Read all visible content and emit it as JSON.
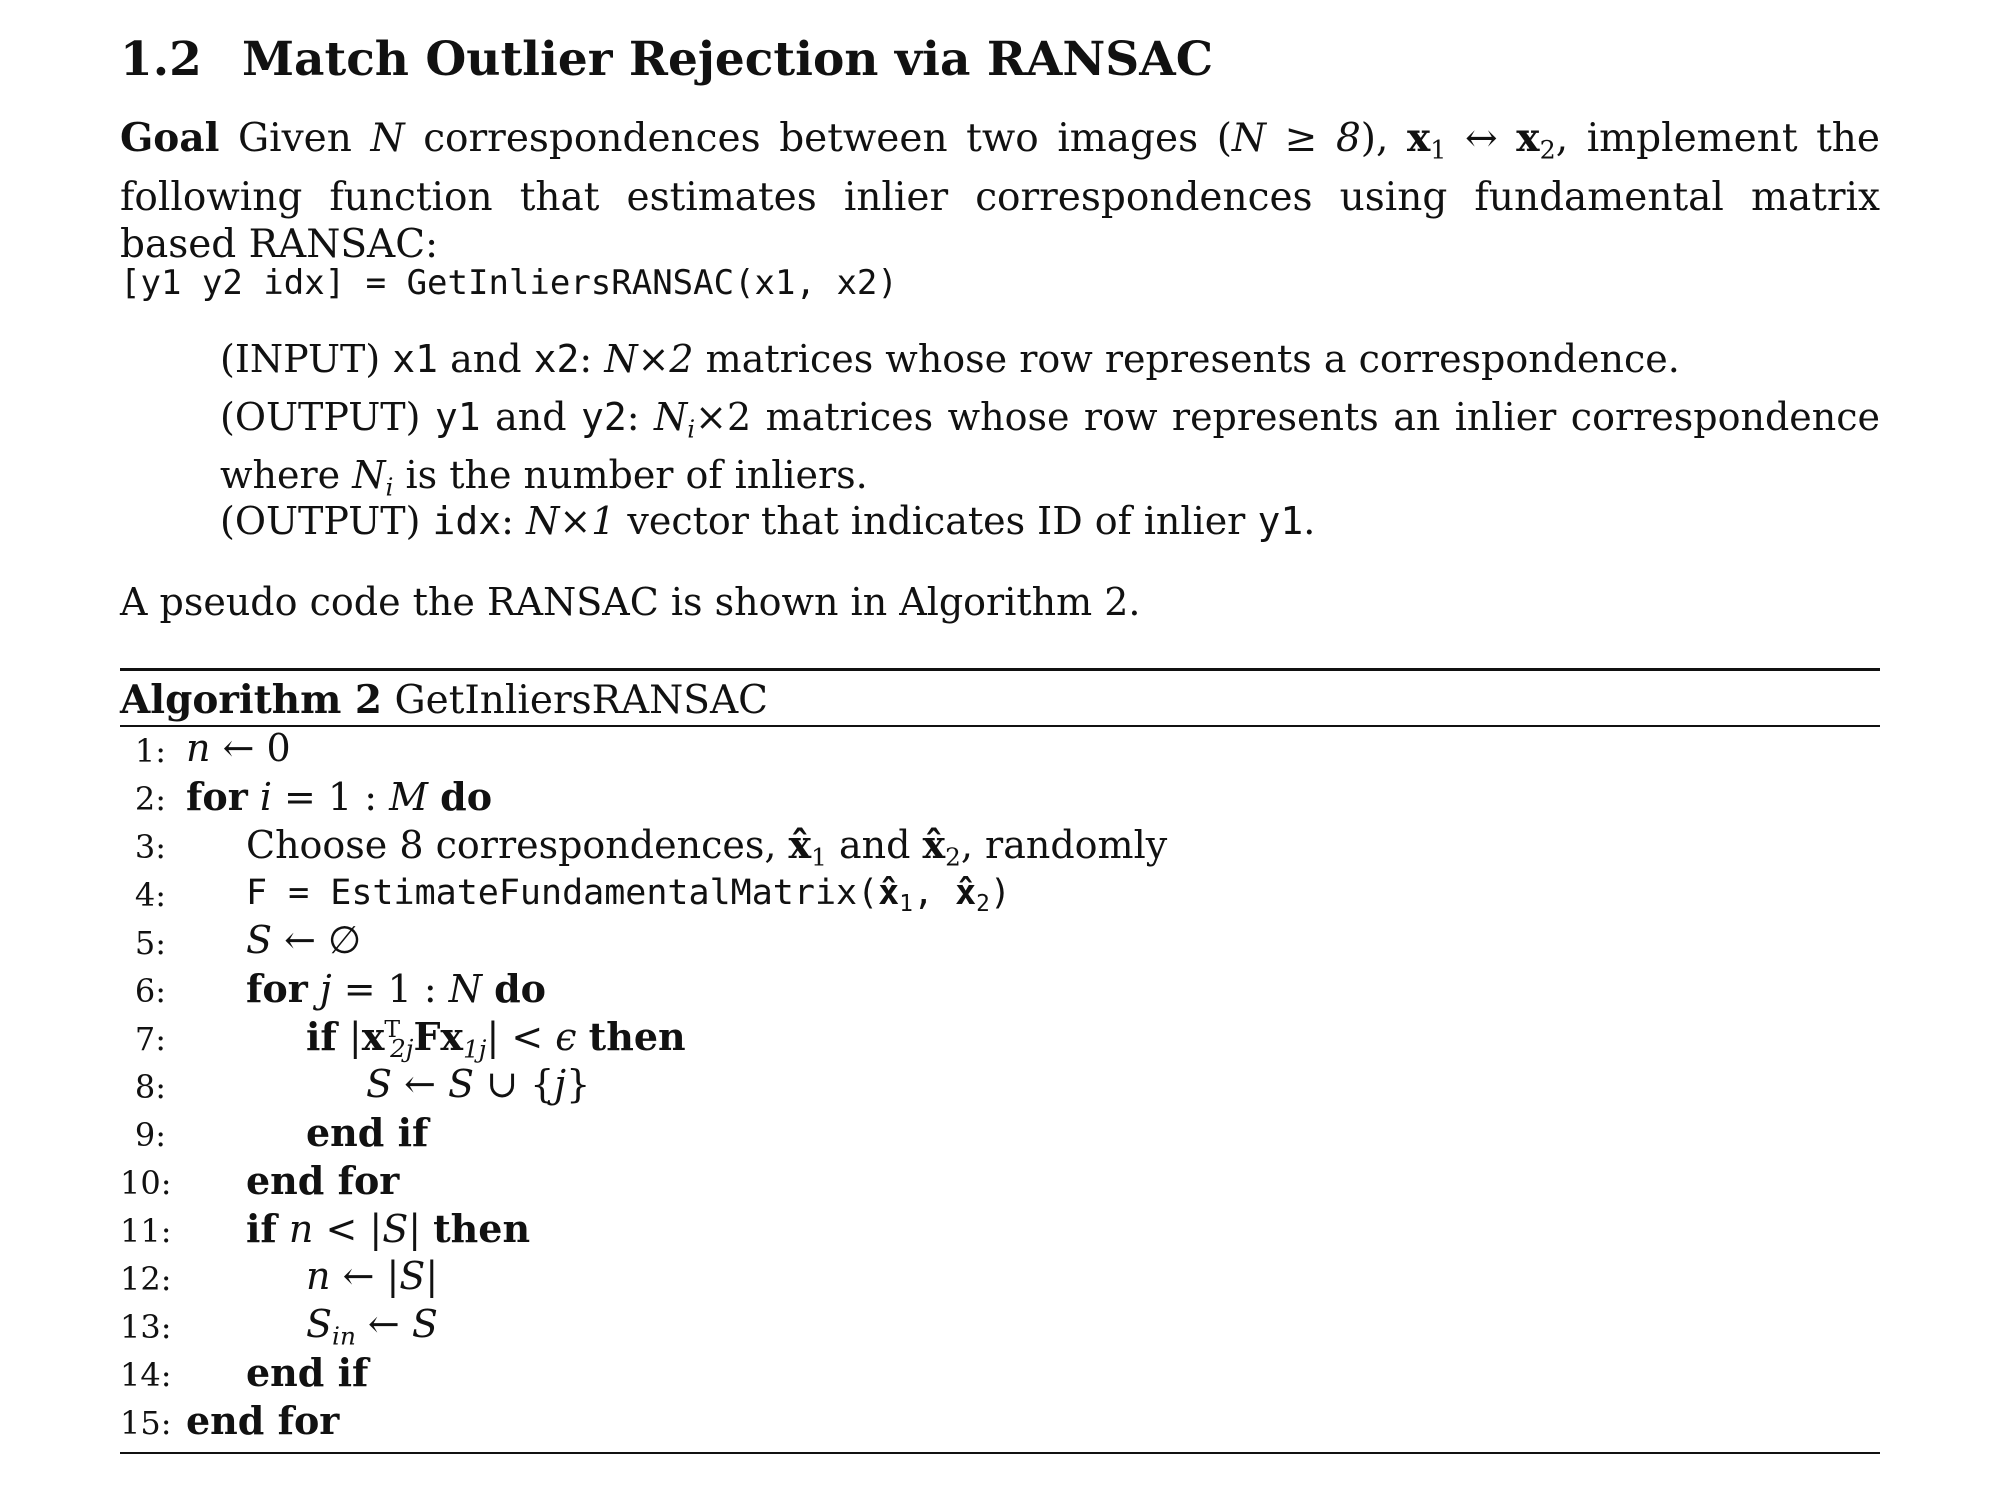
{
  "section": {
    "number": "1.2",
    "title": "Match Outlier Rejection via RANSAC"
  },
  "goal": {
    "label": "Goal",
    "text_a": " Given ",
    "N": "N",
    "text_b": " correspondences between two images (",
    "cond": "N ≥ 8",
    "text_c": "), ",
    "x1": "x",
    "x1_sub": "1",
    "arrow": " ↔ ",
    "x2": "x",
    "x2_sub": "2",
    "text_d": ", implement the following function that estimates inlier correspondences using fundamental matrix based RANSAC:"
  },
  "signature": "[y1 y2 idx] = GetInliersRANSAC(x1, x2)",
  "params": {
    "input": {
      "prefix": "(INPUT) ",
      "v1": "x1",
      "and": " and ",
      "v2": "x2",
      "colon": ": ",
      "dims": "N×2",
      "text": " matrices whose row represents a correspondence."
    },
    "output1": {
      "prefix": "(OUTPUT) ",
      "v1": "y1",
      "and": " and ",
      "v2": "y2",
      "colon": ": ",
      "dims_var": "N",
      "dims_sub": "i",
      "dims_rest": "×2",
      "text": " matrices whose row represents an inlier correspondence where ",
      "ni": "N",
      "ni_sub": "i",
      "text2": " is the number of inliers."
    },
    "output2": {
      "prefix": "(OUTPUT) ",
      "v1": "idx",
      "colon": ": ",
      "dims": "N×1",
      "text": " vector that indicates ID of inlier ",
      "v2": "y1",
      "end": "."
    }
  },
  "reference_text": "A pseudo code the RANSAC is shown in Algorithm 2.",
  "algorithm": {
    "label": "Algorithm 2",
    "name": "GetInliersRANSAC",
    "numbers": [
      "1:",
      "2:",
      "3:",
      "4:",
      "5:",
      "6:",
      "7:",
      "8:",
      "9:",
      "10:",
      "11:",
      "12:",
      "13:",
      "14:",
      "15:"
    ],
    "l1": {
      "n": "n",
      "rest": " ← 0"
    },
    "l2": {
      "kw": "for",
      "i": "i",
      "eq": " = 1 : ",
      "M": "M",
      "do": "do"
    },
    "l3": {
      "text": "Choose 8 correspondences, ",
      "x1": "x̂",
      "s1": "1",
      "and": " and ",
      "x2": "x̂",
      "s2": "2",
      "end": ", randomly"
    },
    "l4": {
      "code": "F = EstimateFundamentalMatrix(",
      "x1": "x̂",
      "s1": "1",
      "comma": ", ",
      "x2": "x̂",
      "s2": "2",
      "close": ")"
    },
    "l5": {
      "S": "S",
      "rest": " ← ∅"
    },
    "l6": {
      "kw": "for",
      "j": "j",
      "eq": " = 1 : ",
      "N": "N",
      "do": "do"
    },
    "l7": {
      "kw": "if",
      "bar1": " |",
      "x": "x",
      "sup": "T",
      "sub": "2j",
      "F": "F",
      "x2": "x",
      "sub2": "1j",
      "bar2": "| < ",
      "eps": "ϵ",
      "then": "then"
    },
    "l8": {
      "S": "S",
      "arrow": " ← ",
      "S2": "S",
      "rest": " ∪ {",
      "j": "j",
      "close": "}"
    },
    "l9": {
      "kw": "end if"
    },
    "l10": {
      "kw": "end for"
    },
    "l11": {
      "kw": "if",
      "n": "n",
      "lt": " < |",
      "S": "S",
      "bar": "| ",
      "then": "then"
    },
    "l12": {
      "n": "n",
      "rest": " ← |",
      "S": "S",
      "bar": "|"
    },
    "l13": {
      "S": "S",
      "sub": "in",
      "arrow": " ← ",
      "S2": "S"
    },
    "l14": {
      "kw": "end if"
    },
    "l15": {
      "kw": "end for"
    }
  }
}
